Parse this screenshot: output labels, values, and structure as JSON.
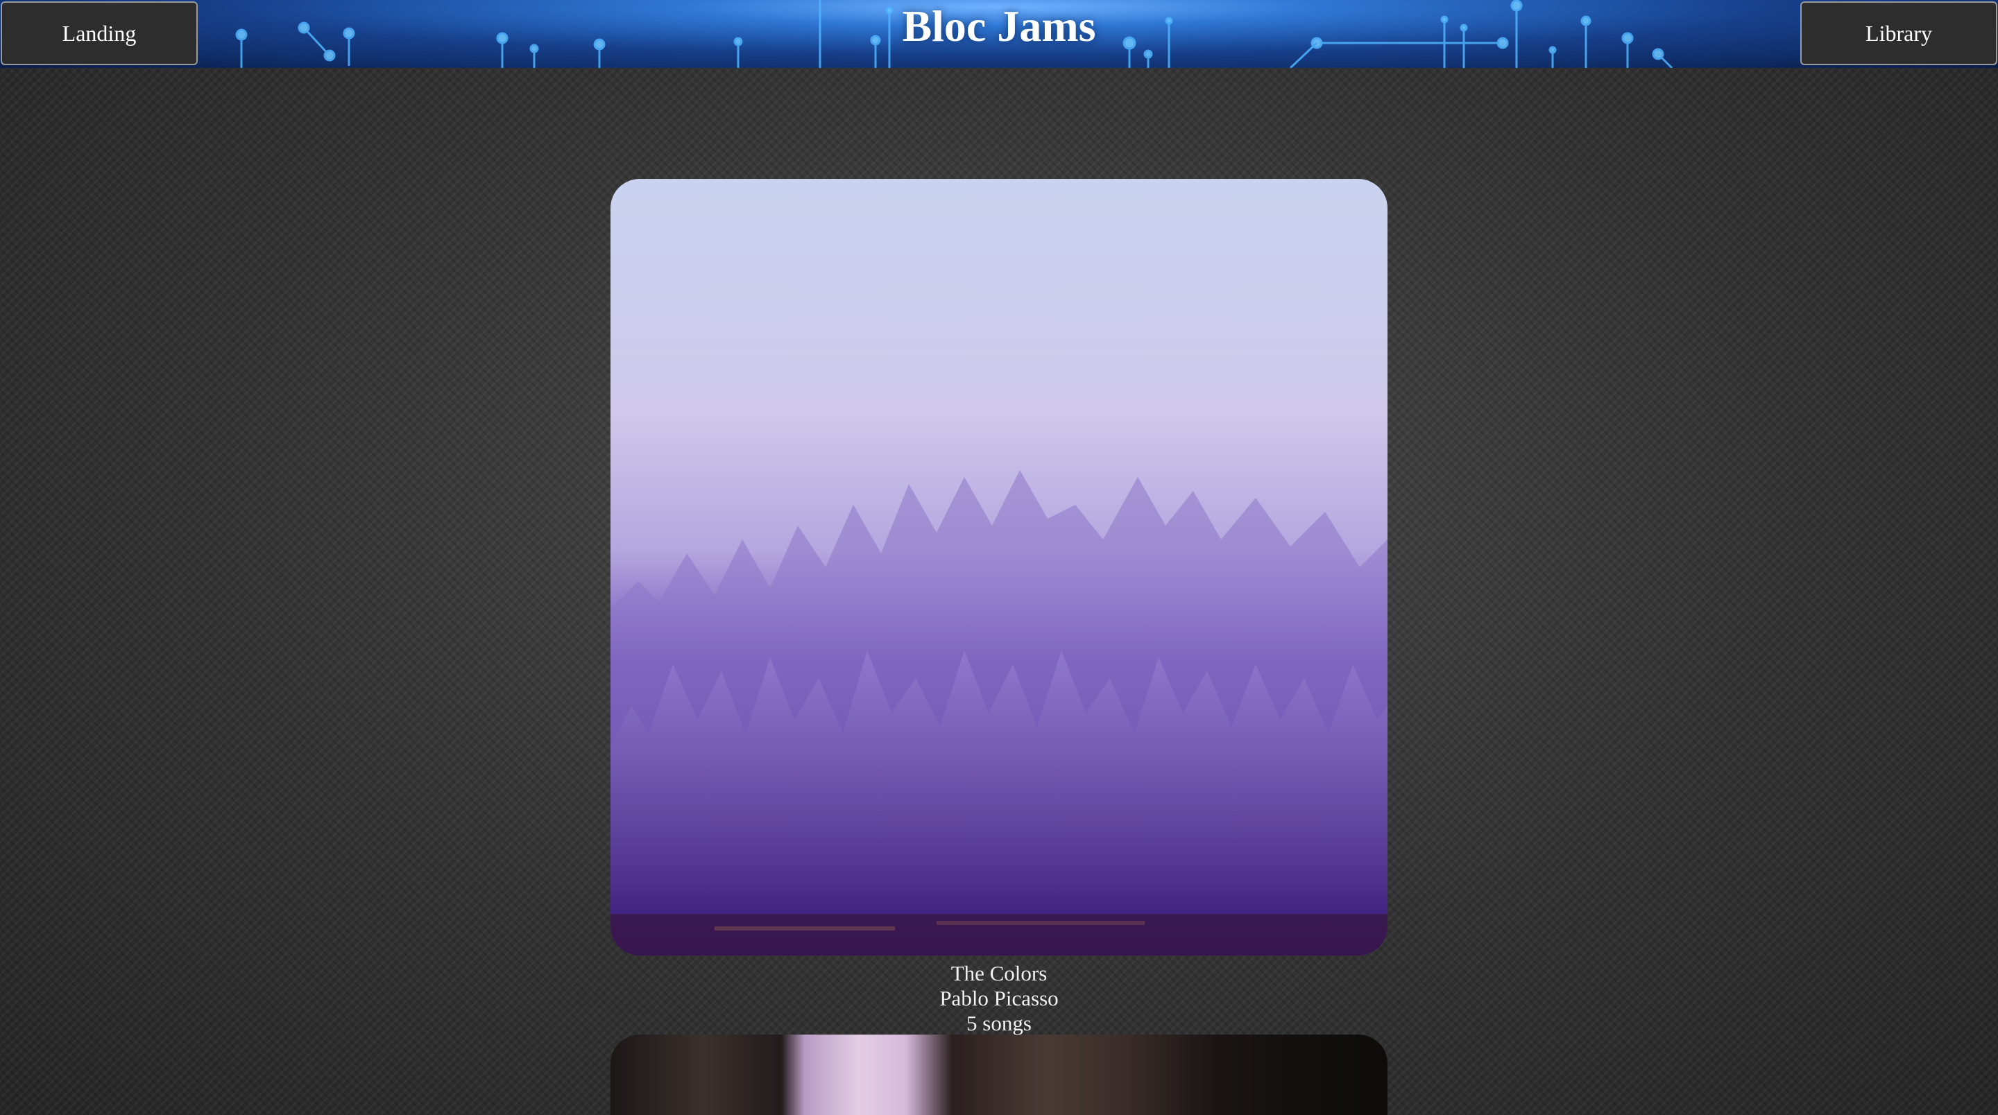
{
  "navbar": {
    "left_button": "Landing",
    "brand": "Bloc Jams",
    "right_button": "Library"
  },
  "albums": [
    {
      "title": "The Colors",
      "artist": "Pablo Picasso",
      "song_count": "5 songs"
    }
  ],
  "colors": {
    "navbar_accent": "#2f78d6",
    "background": "#3a3a3a",
    "cover_tint": "#4a2a94"
  }
}
